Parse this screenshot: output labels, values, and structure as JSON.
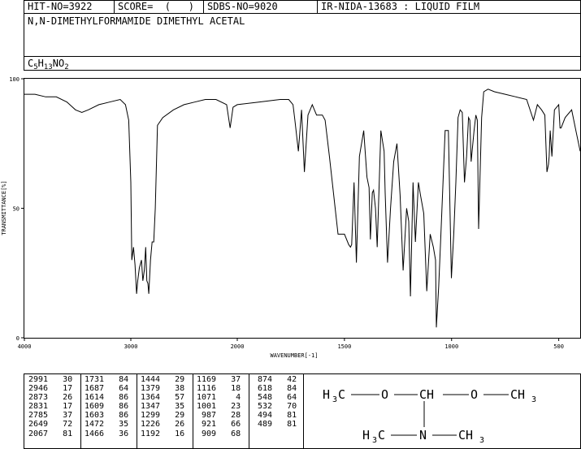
{
  "header": {
    "hit_no": "HIT-NO=3922",
    "score": "SCORE=  (   )",
    "sdbs_no": "SDBS-NO=9020",
    "ir_info": "IR-NIDA-13683 : LIQUID FILM"
  },
  "compound_name": "N,N-DIMETHYLFORMAMIDE DIMETHYL ACETAL",
  "formula": {
    "c": "C",
    "c_n": "5",
    "h": "H",
    "h_n": "13",
    "rest": "NO",
    "o_n": "2"
  },
  "chart_data": {
    "type": "line",
    "xlabel": "WAVENUMBER[-1]",
    "ylabel": "TRANSMITTANCE[%]",
    "xlim": [
      4000,
      400
    ],
    "ylim": [
      0,
      100
    ],
    "x_ticks": [
      "4000",
      "3000",
      "2000",
      "1500",
      "1000",
      "500"
    ],
    "x_tick_values": [
      4000,
      3000,
      2000,
      1500,
      1000,
      500
    ],
    "y_ticks": [
      "100",
      "50",
      "0"
    ],
    "y_tick_values": [
      100,
      50,
      0
    ],
    "grid": false,
    "series": [
      {
        "color": "#000000",
        "x": [
          4000,
          3900,
          3800,
          3700,
          3600,
          3520,
          3460,
          3400,
          3300,
          3200,
          3100,
          3050,
          3020,
          3000,
          2991,
          2975,
          2960,
          2946,
          2935,
          2920,
          2900,
          2887,
          2873,
          2860,
          2850,
          2840,
          2831,
          2815,
          2800,
          2785,
          2770,
          2750,
          2700,
          2600,
          2500,
          2400,
          2300,
          2200,
          2100,
          2067,
          2040,
          2000,
          1900,
          1800,
          1760,
          1740,
          1731,
          1715,
          1700,
          1687,
          1670,
          1650,
          1640,
          1630,
          1614,
          1609,
          1603,
          1590,
          1570,
          1550,
          1530,
          1500,
          1480,
          1472,
          1466,
          1455,
          1444,
          1430,
          1410,
          1395,
          1385,
          1379,
          1370,
          1364,
          1355,
          1347,
          1330,
          1315,
          1310,
          1299,
          1285,
          1270,
          1255,
          1240,
          1226,
          1210,
          1200,
          1192,
          1180,
          1169,
          1155,
          1145,
          1130,
          1116,
          1100,
          1085,
          1075,
          1071,
          1060,
          1050,
          1040,
          1030,
          1015,
          1001,
          990,
          980,
          970,
          960,
          950,
          940,
          930,
          921,
          915,
          909,
          895,
          887,
          880,
          874,
          860,
          850,
          830,
          800,
          750,
          700,
          650,
          618,
          600,
          580,
          565,
          555,
          548,
          545,
          540,
          532,
          520,
          500,
          494,
          489,
          470,
          440,
          420,
          400
        ],
        "y": [
          94,
          94,
          93,
          93,
          91,
          88,
          87,
          88,
          90,
          91,
          92,
          90,
          84,
          60,
          30,
          35,
          28,
          17,
          22,
          27,
          30,
          22,
          26,
          35,
          22,
          21,
          17,
          30,
          37,
          37,
          50,
          82,
          85,
          88,
          90,
          91,
          92,
          92,
          90,
          81,
          89,
          90,
          91,
          92,
          92,
          90,
          84,
          72,
          88,
          64,
          86,
          90,
          88,
          86,
          86,
          86,
          86,
          84,
          70,
          55,
          40,
          40,
          36,
          35,
          36,
          60,
          29,
          70,
          80,
          62,
          58,
          38,
          56,
          57,
          50,
          35,
          80,
          72,
          56,
          29,
          50,
          68,
          75,
          55,
          26,
          50,
          45,
          16,
          60,
          37,
          60,
          55,
          48,
          18,
          40,
          35,
          30,
          4,
          20,
          40,
          60,
          80,
          80,
          23,
          40,
          60,
          85,
          88,
          87,
          60,
          70,
          85,
          84,
          68,
          80,
          86,
          84,
          42,
          85,
          95,
          96,
          95,
          94,
          93,
          92,
          84,
          90,
          88,
          86,
          64,
          67,
          70,
          80,
          70,
          88,
          90,
          81,
          81,
          85,
          88,
          80,
          72
        ]
      }
    ]
  },
  "peak_table": [
    [
      [
        "2991",
        "30"
      ],
      [
        "2946",
        "17"
      ],
      [
        "2873",
        "26"
      ],
      [
        "2831",
        "17"
      ],
      [
        "2785",
        "37"
      ],
      [
        "2649",
        "72"
      ],
      [
        "2067",
        "81"
      ]
    ],
    [
      [
        "1731",
        "84"
      ],
      [
        "1687",
        "64"
      ],
      [
        "1614",
        "86"
      ],
      [
        "1609",
        "86"
      ],
      [
        "1603",
        "86"
      ],
      [
        "1472",
        "35"
      ],
      [
        "1466",
        "36"
      ]
    ],
    [
      [
        "1444",
        "29"
      ],
      [
        "1379",
        "38"
      ],
      [
        "1364",
        "57"
      ],
      [
        "1347",
        "35"
      ],
      [
        "1299",
        "29"
      ],
      [
        "1226",
        "26"
      ],
      [
        "1192",
        "16"
      ]
    ],
    [
      [
        "1169",
        "37"
      ],
      [
        "1116",
        "18"
      ],
      [
        "1071",
        " 4"
      ],
      [
        "1001",
        "23"
      ],
      [
        " 987",
        "28"
      ],
      [
        " 921",
        "66"
      ],
      [
        " 909",
        "68"
      ]
    ],
    [
      [
        " 874",
        "42"
      ],
      [
        " 618",
        "84"
      ],
      [
        " 548",
        "64"
      ],
      [
        " 532",
        "70"
      ],
      [
        " 494",
        "81"
      ],
      [
        " 489",
        "81"
      ]
    ]
  ],
  "structure": {
    "top_left_c": "C",
    "h3": "3",
    "h": "H",
    "o": "O",
    "ch": "CH",
    "ch3": "CH",
    "n": "N"
  }
}
